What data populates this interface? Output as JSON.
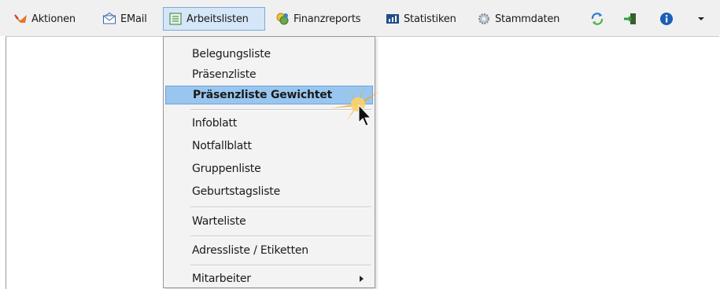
{
  "toolbar": {
    "aktionen": "Aktionen",
    "email": "EMail",
    "arbeitslisten": "Arbeitslisten",
    "finanzreports": "Finanzreports",
    "statistiken": "Statistiken",
    "stammdaten": "Stammdaten",
    "icons": [
      "actions-icon",
      "email-icon",
      "list-icon",
      "finance-icon",
      "statistics-icon",
      "settings-gear-icon",
      "refresh-icon",
      "exit-icon",
      "info-icon",
      "dropdown-arrow-icon"
    ]
  },
  "menu": {
    "items": [
      {
        "label": "Belegungsliste"
      },
      {
        "label": "Präsenzliste"
      },
      {
        "label": "Präsenzliste Gewichtet",
        "highlighted": true,
        "submenu": true
      },
      {
        "label": "Infoblatt"
      },
      {
        "label": "Notfallblatt"
      },
      {
        "label": "Gruppenliste"
      },
      {
        "label": "Geburtstagsliste"
      },
      {
        "label": "Warteliste"
      },
      {
        "label": "Adressliste / Etiketten"
      },
      {
        "label": "Mitarbeiter",
        "submenu": true
      }
    ]
  },
  "colors": {
    "highlight": "#99c6ef",
    "active_button": "#d4e6f7",
    "toolbar": "#f0f0f0",
    "cursor_burst": "#f5a623"
  }
}
